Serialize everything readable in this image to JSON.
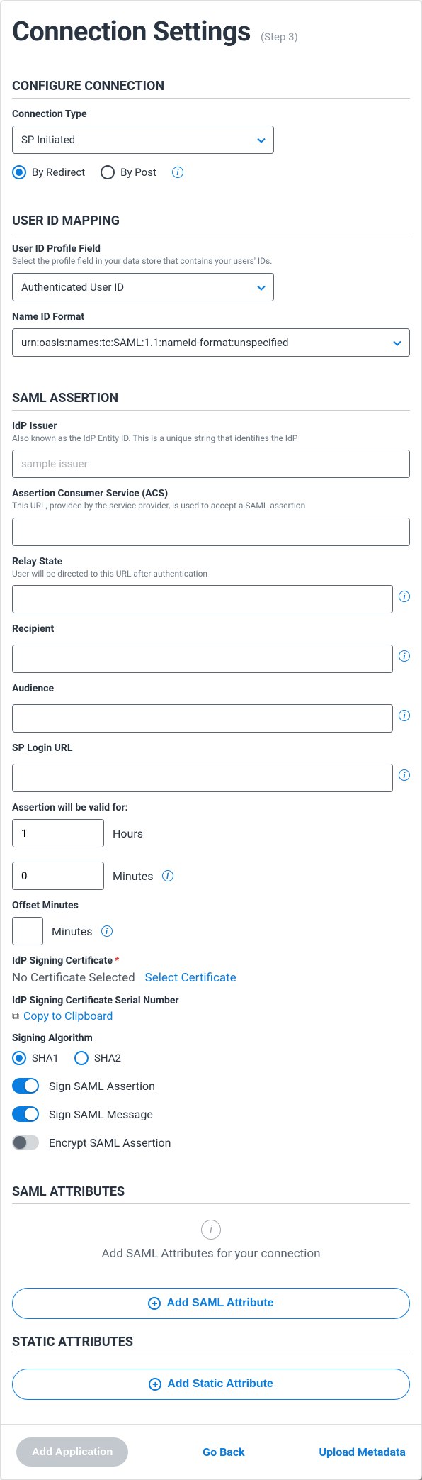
{
  "header": {
    "title": "Connection Settings",
    "step": "(Step 3)"
  },
  "configure": {
    "section": "CONFIGURE CONNECTION",
    "connectionTypeLabel": "Connection Type",
    "connectionTypeValue": "SP Initiated",
    "byRedirect": "By Redirect",
    "byPost": "By Post"
  },
  "userIdMapping": {
    "section": "USER ID MAPPING",
    "profileFieldLabel": "User ID Profile Field",
    "profileFieldHint": "Select the profile field in your data store that contains your users' IDs.",
    "profileFieldValue": "Authenticated User ID",
    "nameIdFormatLabel": "Name ID Format",
    "nameIdFormatValue": "urn:oasis:names:tc:SAML:1.1:nameid-format:unspecified"
  },
  "samlAssertion": {
    "section": "SAML ASSERTION",
    "idpIssuerLabel": "IdP Issuer",
    "idpIssuerHint": "Also known as the IdP Entity ID. This is a unique string that identifies the IdP",
    "idpIssuerPlaceholder": "sample-issuer",
    "acsLabel": "Assertion Consumer Service (ACS)",
    "acsHint": "This URL, provided by the service provider, is used to accept a SAML assertion",
    "relayStateLabel": "Relay State",
    "relayStateHint": "User will be directed to this URL after authentication",
    "recipientLabel": "Recipient",
    "audienceLabel": "Audience",
    "spLoginLabel": "SP Login URL",
    "assertionValidLabel": "Assertion will be valid for:",
    "hoursValue": "1",
    "hoursUnit": "Hours",
    "minutesValue": "0",
    "minutesUnit": "Minutes",
    "offsetLabel": "Offset Minutes",
    "offsetUnit": "Minutes",
    "signingCertLabel": "IdP Signing Certificate",
    "noCertText": "No Certificate Selected",
    "selectCertLink": "Select Certificate",
    "serialLabel": "IdP Signing Certificate Serial Number",
    "copyLink": "Copy to Clipboard",
    "algoLabel": "Signing Algorithm",
    "sha1": "SHA1",
    "sha2": "SHA2",
    "signAssertion": "Sign SAML Assertion",
    "signMessage": "Sign SAML Message",
    "encryptAssertion": "Encrypt SAML Assertion"
  },
  "samlAttributes": {
    "section": "SAML ATTRIBUTES",
    "emptyText": "Add SAML Attributes for your connection",
    "addBtn": "Add SAML Attribute"
  },
  "staticAttributes": {
    "section": "STATIC ATTRIBUTES",
    "addBtn": "Add Static Attribute"
  },
  "footer": {
    "addApp": "Add Application",
    "goBack": "Go Back",
    "upload": "Upload Metadata"
  }
}
